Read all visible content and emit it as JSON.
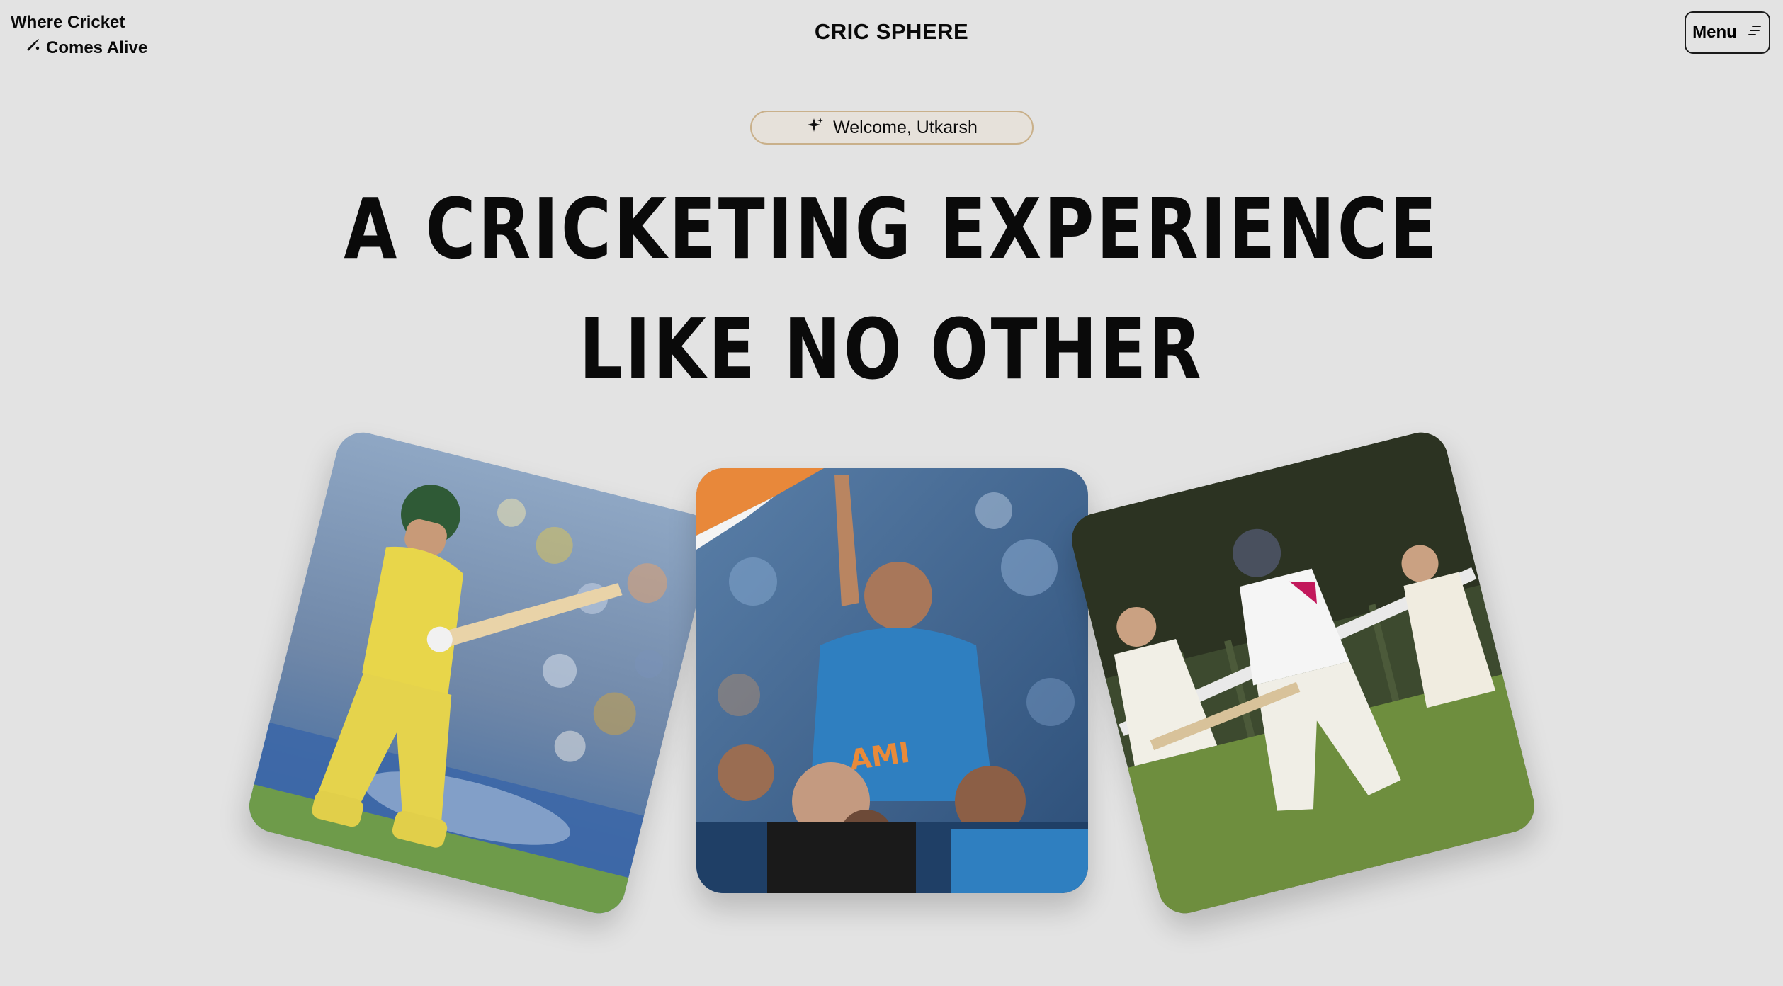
{
  "header": {
    "tagline_line1": "Where Cricket",
    "tagline_line2": "Comes Alive",
    "tagline_icon": "cricket-bat-icon",
    "brand": "CRIC SPHERE",
    "menu_label": "Menu",
    "menu_icon": "menu-lines-icon"
  },
  "welcome": {
    "icon": "sparkle-icon",
    "text": "Welcome, Utkarsh"
  },
  "hero": {
    "line1": "A CRICKETING EXPERIENCE",
    "line2": "LIKE NO OTHER"
  },
  "gallery": {
    "cards": [
      {
        "name": "batsman-yellow-kit-photo",
        "accent": "#e8d64a"
      },
      {
        "name": "celebration-blue-kit-photo",
        "accent": "#2f7fc0"
      },
      {
        "name": "village-cricket-photo",
        "accent": "#6e8e3e"
      }
    ]
  },
  "colors": {
    "background": "#e3e3e3",
    "pill_border": "#c9b08a",
    "text": "#0a0a0a"
  }
}
